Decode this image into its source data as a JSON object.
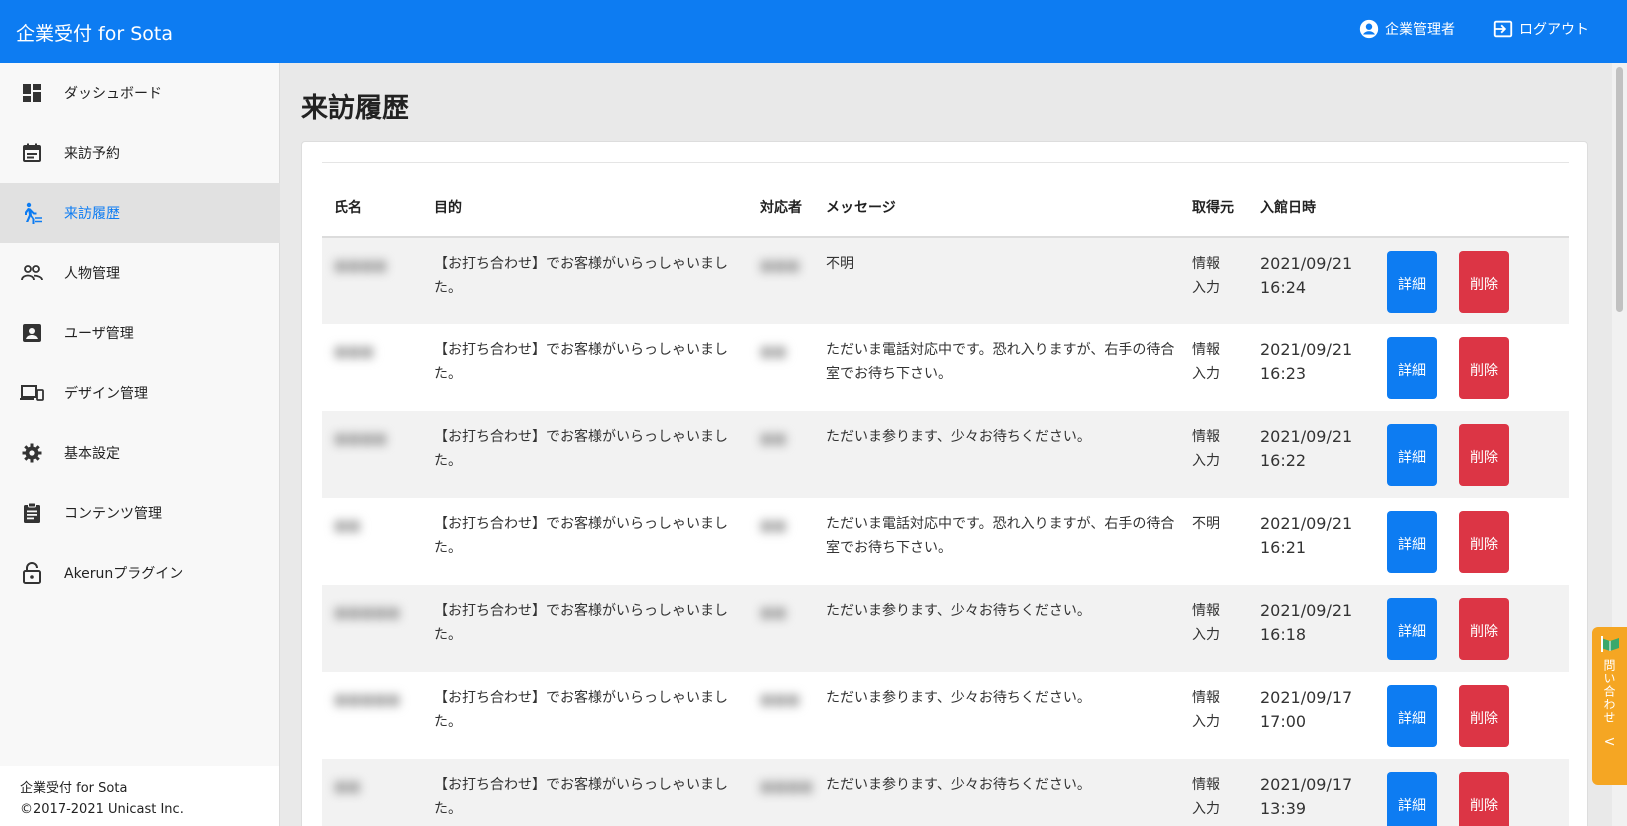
{
  "header": {
    "brand": "企業受付 for Sota",
    "user_label": "企業管理者",
    "logout_label": "ログアウト"
  },
  "sidebar": {
    "items": [
      {
        "label": "ダッシュボード",
        "icon": "dashboard-icon"
      },
      {
        "label": "来訪予約",
        "icon": "calendar-icon"
      },
      {
        "label": "来訪履歴",
        "icon": "walking-person-icon",
        "active": true
      },
      {
        "label": "人物管理",
        "icon": "people-icon"
      },
      {
        "label": "ユーザ管理",
        "icon": "user-badge-icon"
      },
      {
        "label": "デザイン管理",
        "icon": "devices-icon"
      },
      {
        "label": "基本設定",
        "icon": "gear-icon"
      },
      {
        "label": "コンテンツ管理",
        "icon": "clipboard-icon"
      },
      {
        "label": "Akerunプラグイン",
        "icon": "lock-open-icon"
      }
    ],
    "footer": {
      "line1": "企業受付 for Sota",
      "line2": "©2017-2021 Unicast Inc."
    }
  },
  "main": {
    "title": "来訪履歴",
    "table": {
      "columns": [
        "氏名",
        "目的",
        "対応者",
        "メッセージ",
        "取得元",
        "入館日時"
      ],
      "detail_label": "詳細",
      "delete_label": "削除",
      "rows": [
        {
          "name": "■■■■",
          "purpose": "【お打ち合わせ】でお客様がいらっしゃいました。",
          "handler": "■■■",
          "message": "不明",
          "source": "情報入力",
          "datetime": "2021/09/21 16:24"
        },
        {
          "name": "■■■",
          "purpose": "【お打ち合わせ】でお客様がいらっしゃいました。",
          "handler": "■■",
          "message": "ただいま電話対応中です。恐れ入りますが、右手の待合室でお待ち下さい。",
          "source": "情報入力",
          "datetime": "2021/09/21 16:23"
        },
        {
          "name": "■■■■",
          "purpose": "【お打ち合わせ】でお客様がいらっしゃいました。",
          "handler": "■■",
          "message": "ただいま参ります、少々お待ちください。",
          "source": "情報入力",
          "datetime": "2021/09/21 16:22"
        },
        {
          "name": "■■",
          "purpose": "【お打ち合わせ】でお客様がいらっしゃいました。",
          "handler": "■■",
          "message": "ただいま電話対応中です。恐れ入りますが、右手の待合室でお待ち下さい。",
          "source": "不明",
          "datetime": "2021/09/21 16:21"
        },
        {
          "name": "■■■■■",
          "purpose": "【お打ち合わせ】でお客様がいらっしゃいました。",
          "handler": "■■",
          "message": "ただいま参ります、少々お待ちください。",
          "source": "情報入力",
          "datetime": "2021/09/21 16:18"
        },
        {
          "name": "■■■■■",
          "purpose": "【お打ち合わせ】でお客様がいらっしゃいました。",
          "handler": "■■■",
          "message": "ただいま参ります、少々お待ちください。",
          "source": "情報入力",
          "datetime": "2021/09/17 17:00"
        },
        {
          "name": "■■",
          "purpose": "【お打ち合わせ】でお客様がいらっしゃいました。",
          "handler": "■■■■",
          "message": "ただいま参ります、少々お待ちください。",
          "source": "情報入力",
          "datetime": "2021/09/17 13:39"
        }
      ]
    }
  },
  "contact_tab": {
    "label": "問い合わせ",
    "chevron": "<"
  },
  "colors": {
    "primary": "#0d7cf2",
    "danger": "#dc3545",
    "contact": "#f5a623"
  }
}
